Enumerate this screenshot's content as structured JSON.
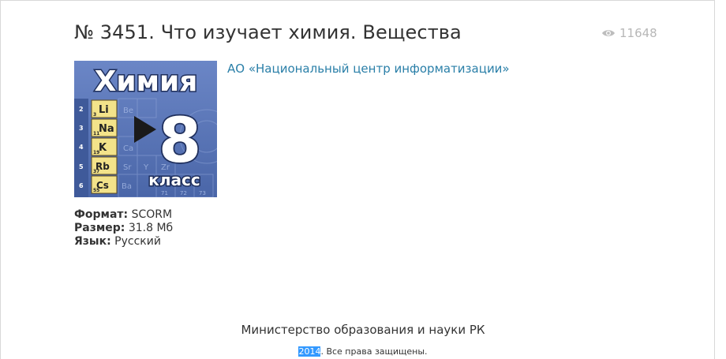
{
  "resource": {
    "title": "№ 3451. Что изучает химия. Вещества",
    "views": "11648",
    "publisher": "АО «Национальный центр информатизации»"
  },
  "cover": {
    "heading": "Химия",
    "grade_number": "8",
    "grade_word": "класс",
    "rows": [
      "2",
      "3",
      "4",
      "5",
      "6"
    ],
    "elements": [
      {
        "symbol": "Li",
        "number": "3"
      },
      {
        "symbol": "Na",
        "number": "11"
      },
      {
        "symbol": "K",
        "number": "19"
      },
      {
        "symbol": "Rb",
        "number": "37"
      },
      {
        "symbol": "Cs",
        "number": "55"
      }
    ],
    "faded": [
      "Be",
      "Ca",
      "Sr",
      "Y",
      "Zr",
      "Ba",
      "71",
      "72",
      "73"
    ]
  },
  "details": {
    "format_label": "Формат:",
    "format_value": "SCORM",
    "size_label": "Размер:",
    "size_value": "31.8 Мб",
    "language_label": "Язык:",
    "language_value": "Русский"
  },
  "footer": {
    "organization": "Министерство образования и науки РК",
    "year": "2014",
    "rights": ". Все права защищены."
  },
  "colors": {
    "link": "#2a7fa8",
    "cover_bg": "#5b78b8",
    "element_cell": "#f3e38a",
    "selection": "#3399ff"
  },
  "icons": {
    "views": "eye-icon",
    "play": "play-icon"
  }
}
